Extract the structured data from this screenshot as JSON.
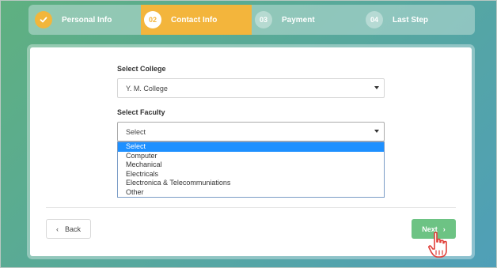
{
  "steps": [
    {
      "number": "",
      "label": "Personal Info",
      "state": "completed",
      "icon": "check-icon"
    },
    {
      "number": "02",
      "label": "Contact Info",
      "state": "active"
    },
    {
      "number": "03",
      "label": "Payment",
      "state": "pending"
    },
    {
      "number": "04",
      "label": "Last Step",
      "state": "pending"
    }
  ],
  "form": {
    "college": {
      "label": "Select College",
      "value": "Y. M. College"
    },
    "faculty": {
      "label": "Select Faculty",
      "value": "Select",
      "options": [
        "Select",
        "Computer",
        "Mechanical",
        "Electricals",
        "Electronica & Telecommuniations",
        "Other"
      ],
      "highlighted_option": "Select"
    }
  },
  "buttons": {
    "back_label": "Back",
    "next_label": "Next"
  },
  "colors": {
    "accent": "#f3b53c",
    "next_button": "#6dc384",
    "highlight": "#1e90ff"
  }
}
